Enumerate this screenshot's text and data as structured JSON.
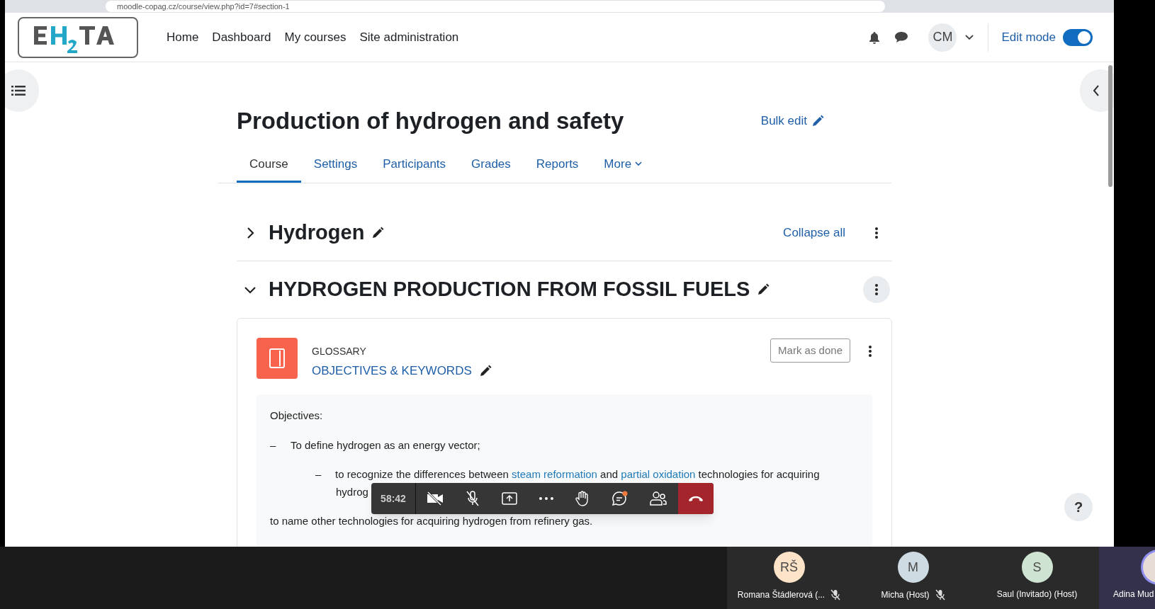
{
  "browser": {
    "url": "moodle-copag.cz/course/view.php?id=7#section-1"
  },
  "navbar": {
    "links": [
      {
        "label": "Home"
      },
      {
        "label": "Dashboard"
      },
      {
        "label": "My courses"
      },
      {
        "label": "Site administration"
      }
    ],
    "user_initials": "CM",
    "edit_mode": {
      "label": "Edit mode",
      "on": true
    }
  },
  "course": {
    "title": "Production of hydrogen and safety",
    "bulk_edit": "Bulk edit",
    "tabs": [
      {
        "label": "Course",
        "selected": true
      },
      {
        "label": "Settings",
        "selected": false
      },
      {
        "label": "Participants",
        "selected": false
      },
      {
        "label": "Grades",
        "selected": false
      },
      {
        "label": "Reports",
        "selected": false
      },
      {
        "label": "More",
        "selected": false
      }
    ],
    "collapse_all": "Collapse all",
    "sections": [
      {
        "title": "Hydrogen",
        "expanded": false
      },
      {
        "title": "HYDROGEN PRODUCTION FROM FOSSIL FUELS",
        "expanded": true
      }
    ],
    "activity": {
      "type": "GLOSSARY",
      "name": "OBJECTIVES & KEYWORDS",
      "button": "Mark as done",
      "content": [
        {
          "kind": "label",
          "parts": [
            {
              "text": "Objectives:"
            }
          ]
        },
        {
          "kind": "bullet",
          "marker": "–",
          "parts": [
            {
              "text": "To define hydrogen as an energy vector;"
            }
          ]
        },
        {
          "kind": "subbullet",
          "marker": "–",
          "parts": [
            {
              "text": "to recognize the differences between "
            },
            {
              "text": "steam reformation",
              "link": true
            },
            {
              "text": " and "
            },
            {
              "text": "partial oxidation",
              "link": true
            },
            {
              "text": " technologies for acquiring"
            }
          ]
        },
        {
          "kind": "continuation",
          "parts": [
            {
              "text": "hydrog"
            }
          ]
        },
        {
          "kind": "label",
          "parts": [
            {
              "text": "to name other technologies for acquiring hydrogen from refinery gas."
            }
          ]
        }
      ]
    }
  },
  "call": {
    "timer": "58:42",
    "chat_unread": true
  },
  "help": "?",
  "participants": [
    {
      "initials": "RŠ",
      "name": "Romana Štádlerová (...",
      "color": "#fde3c8",
      "muted": true
    },
    {
      "initials": "M",
      "name": "Micha (Host)",
      "color": "#cfdbe3",
      "muted": true
    },
    {
      "initials": "S",
      "name": "Saul (Invitado) (Host)",
      "color": "#cfe3d3",
      "muted": false
    },
    {
      "name": "Adina Mud",
      "color": "#e8dcd6",
      "muted": false
    }
  ]
}
